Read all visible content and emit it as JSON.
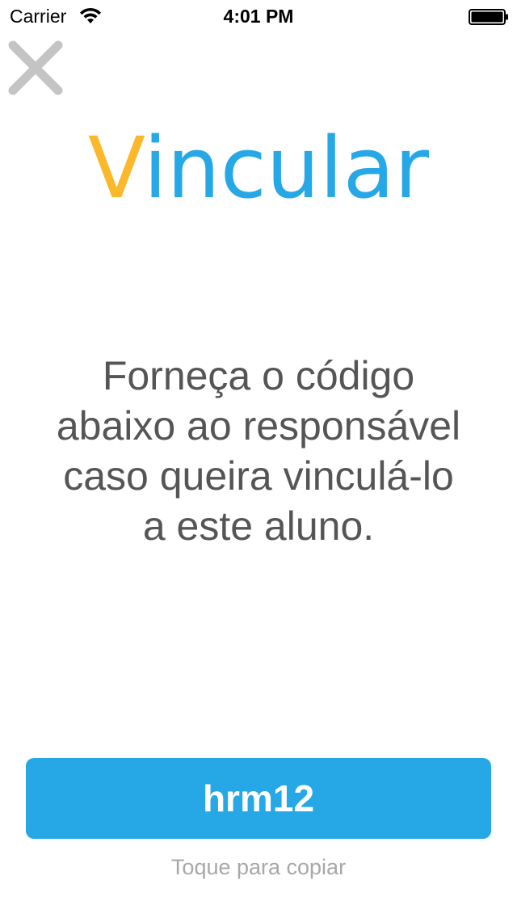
{
  "status_bar": {
    "carrier": "Carrier",
    "time": "4:01 PM",
    "wifi_icon": "wifi-icon",
    "battery_icon": "battery-full-icon"
  },
  "header": {
    "close_icon": "close-icon",
    "title_first_letter": "V",
    "title_rest": "incular"
  },
  "main": {
    "instruction": "Forneça o código abaixo ao responsável caso queira vinculá-lo a este aluno.",
    "code": "hrm12",
    "copy_hint": "Toque para copiar"
  },
  "colors": {
    "accent_blue": "#27a8e6",
    "accent_yellow": "#fbb82a",
    "text_gray": "#555555",
    "hint_gray": "#a8a8a8"
  }
}
